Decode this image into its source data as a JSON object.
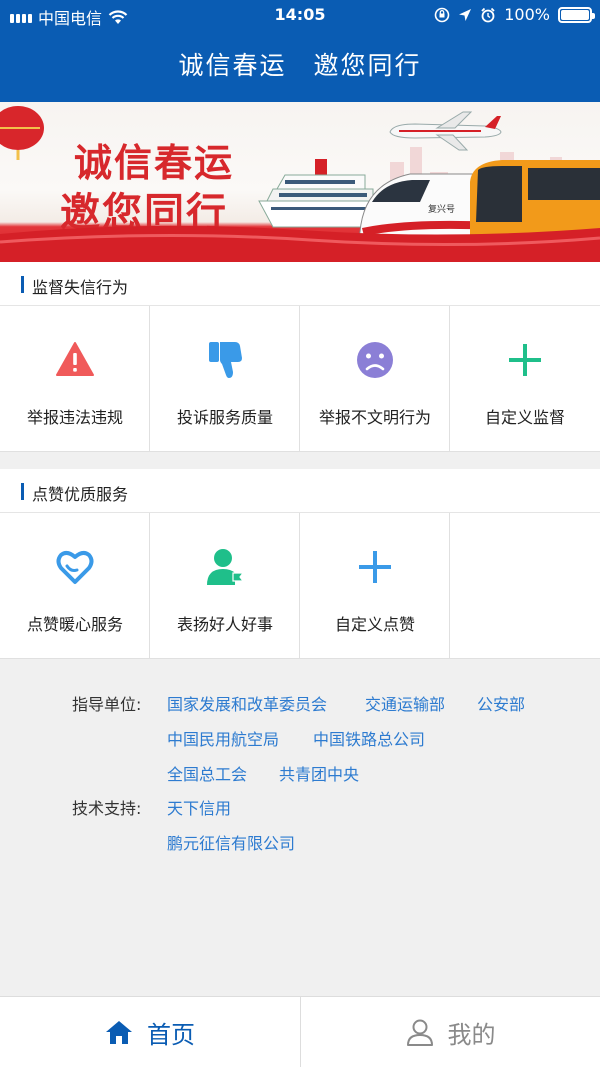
{
  "status_bar": {
    "carrier": "中国电信",
    "time": "14:05",
    "battery": "100%"
  },
  "header": {
    "title": "诚信春运　邀您同行"
  },
  "banner": {
    "line1": "诚信春运",
    "line2": "邀您同行",
    "train_text": "复兴号"
  },
  "sections": [
    {
      "title": "监督失信行为",
      "items": [
        {
          "label": "举报违法违规",
          "icon": "warning-icon",
          "color": "#f05a5a"
        },
        {
          "label": "投诉服务质量",
          "icon": "thumbs-down-icon",
          "color": "#3a9ae8"
        },
        {
          "label": "举报不文明行为",
          "icon": "sad-face-icon",
          "color": "#8b7fd6"
        },
        {
          "label": "自定义监督",
          "icon": "plus-icon",
          "color": "#1fbf8a"
        }
      ]
    },
    {
      "title": "点赞优质服务",
      "items": [
        {
          "label": "点赞暖心服务",
          "icon": "heart-icon",
          "color": "#3a9ae8"
        },
        {
          "label": "表扬好人好事",
          "icon": "person-flag-icon",
          "color": "#1fbf8a"
        },
        {
          "label": "自定义点赞",
          "icon": "plus-icon",
          "color": "#3a9ae8"
        }
      ]
    }
  ],
  "info": {
    "guide_label": "指导单位:",
    "guide_units": [
      "国家发展和改革委员会",
      "交通运输部",
      "公安部",
      "中国民用航空局",
      "中国铁路总公司",
      "全国总工会",
      "共青团中央"
    ],
    "tech_label": "技术支持:",
    "tech_units": [
      "天下信用",
      "鹏元征信有限公司"
    ]
  },
  "tabs": [
    {
      "label": "首页",
      "icon": "home-icon",
      "active": true
    },
    {
      "label": "我的",
      "icon": "user-icon",
      "active": false
    }
  ],
  "colors": {
    "primary": "#0a5cb3",
    "link": "#2d7bd0",
    "banner_red": "#d52027"
  }
}
